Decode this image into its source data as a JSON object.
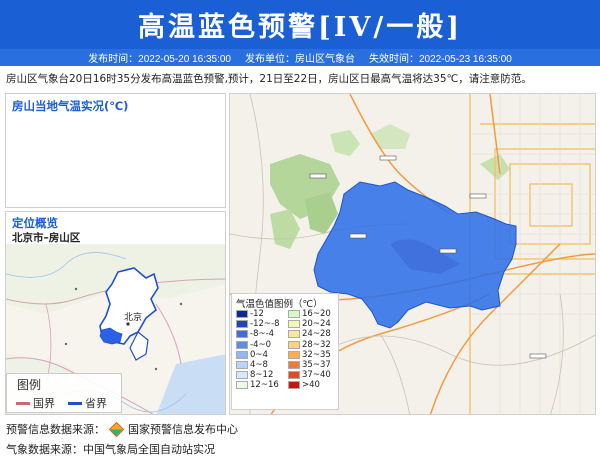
{
  "header": {
    "title": "高温蓝色预警[IV/一般]",
    "publish_time": "发布时间：2022-05-20 16:35:00",
    "publisher": "发布单位：房山区气象台",
    "expire_time": "失效时间：2022-05-23 16:35:00"
  },
  "description": "房山区气象台20日16时35分发布高温蓝色预警,预计，21日至22日，房山区日最高气温将达35℃，请注意防范。",
  "panels": {
    "observation_title": "房山当地气温实况(℃)",
    "location_title": "定位概览",
    "location_subtitle": "北京市–房山区"
  },
  "location_map": {
    "city_label": "北京",
    "legend_title": "图例",
    "legend_country": "国界",
    "legend_province": "省界",
    "colors": {
      "country_border": "#d06a6a",
      "province_border": "#1f4fd0",
      "highlight": "#2b60e8"
    }
  },
  "temperature_legend": {
    "title": "气温色值图例（℃）",
    "items": [
      {
        "label": "-12",
        "color": "#0a2a8c"
      },
      {
        "label": "16~20",
        "color": "#d9f7c6"
      },
      {
        "label": "-12~-8",
        "color": "#1f47b8"
      },
      {
        "label": "20~24",
        "color": "#f3f7b8"
      },
      {
        "label": "-8~-4",
        "color": "#3e6fd8"
      },
      {
        "label": "24~28",
        "color": "#fbe79b"
      },
      {
        "label": "-4~0",
        "color": "#5b8fe6"
      },
      {
        "label": "28~32",
        "color": "#fcd27f"
      },
      {
        "label": "0~4",
        "color": "#8fb8f2"
      },
      {
        "label": "32~35",
        "color": "#f9ae5a"
      },
      {
        "label": "4~8",
        "color": "#b7d5f8"
      },
      {
        "label": "35~37",
        "color": "#f27a35"
      },
      {
        "label": "8~12",
        "color": "#d6e8fb"
      },
      {
        "label": "37~40",
        "color": "#e24a1f"
      },
      {
        "label": "12~16",
        "color": "#eefae6"
      },
      {
        "label": ">40",
        "color": "#c91414"
      }
    ]
  },
  "footer": {
    "warning_source_label": "预警信息数据来源：",
    "warning_source_name": "国家预警信息发布中心",
    "weather_source": "气象数据来源：中国气象局全国自动站实况"
  },
  "colors": {
    "banner": "#1a5fd4",
    "meta_bar": "#2a6fe0",
    "warning_area": "#2f6fe8",
    "panel_title": "#1a5fd4"
  }
}
